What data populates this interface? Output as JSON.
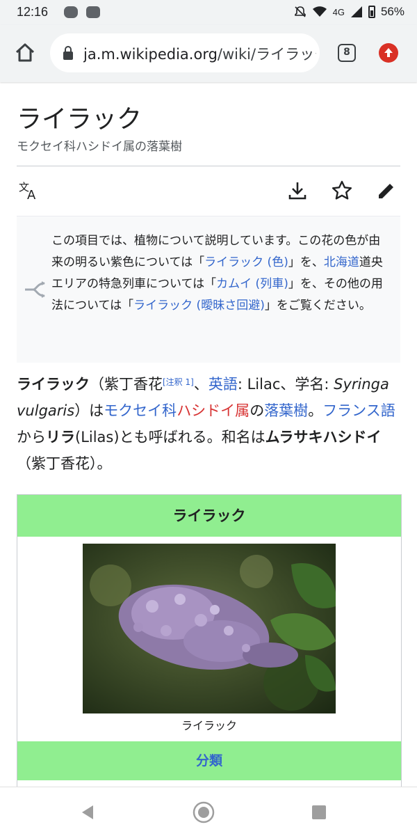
{
  "status_bar": {
    "time": "12:16",
    "network": "4G",
    "battery": "56%",
    "app_icons": [
      "line-icon",
      "youtube-icon"
    ]
  },
  "browser": {
    "url_domain": "ja.m.wikipedia.org",
    "url_path": "/wiki/ライラック",
    "tab_count": "8"
  },
  "article": {
    "title": "ライラック",
    "description": "モクセイ科ハシドイ属の落葉樹",
    "actions": [
      "translate-icon",
      "download-icon",
      "star-icon",
      "edit-icon"
    ],
    "hatnote": {
      "t1": "この項目では、植物について説明しています。この花の色が由来の明るい紫色については「",
      "l1": "ライラック (色)",
      "t2": "」を、",
      "l2": "北海道",
      "t3": "道央エリアの特急列車については「",
      "l3": "カムイ (列車)",
      "t4": "」を、その他の用法については「",
      "l4": "ライラック (曖昧さ回避)",
      "t5": "」をご覧ください。"
    },
    "lead": {
      "b1": "ライラック",
      "t1": "（紫丁香花",
      "note": "[注釈 1]",
      "t2": "、",
      "l_english": "英語",
      "t3": ": Lilac、学名: ",
      "sci": "Syringa vulgaris",
      "t4": "）は",
      "l_family": "モクセイ科",
      "l_genus": "ハシドイ属",
      "t5": "の",
      "l_deciduous": "落葉樹",
      "t6": "。",
      "l_french": "フランス語",
      "t7": "から",
      "b2": "リラ",
      "t8": "(Lilas)とも呼ばれる。和名は",
      "b3": "ムラサキハシドイ",
      "t9": "（紫丁香花）。"
    },
    "infobox": {
      "header": "ライラック",
      "caption": "ライラック",
      "section": "分類"
    }
  },
  "colors": {
    "link": "#3366cc",
    "redlink": "#d73333",
    "infobox_green": "#90ee90",
    "chrome_bg": "#f1f3f4"
  },
  "nav": [
    "back-icon",
    "home-icon",
    "recents-icon"
  ]
}
